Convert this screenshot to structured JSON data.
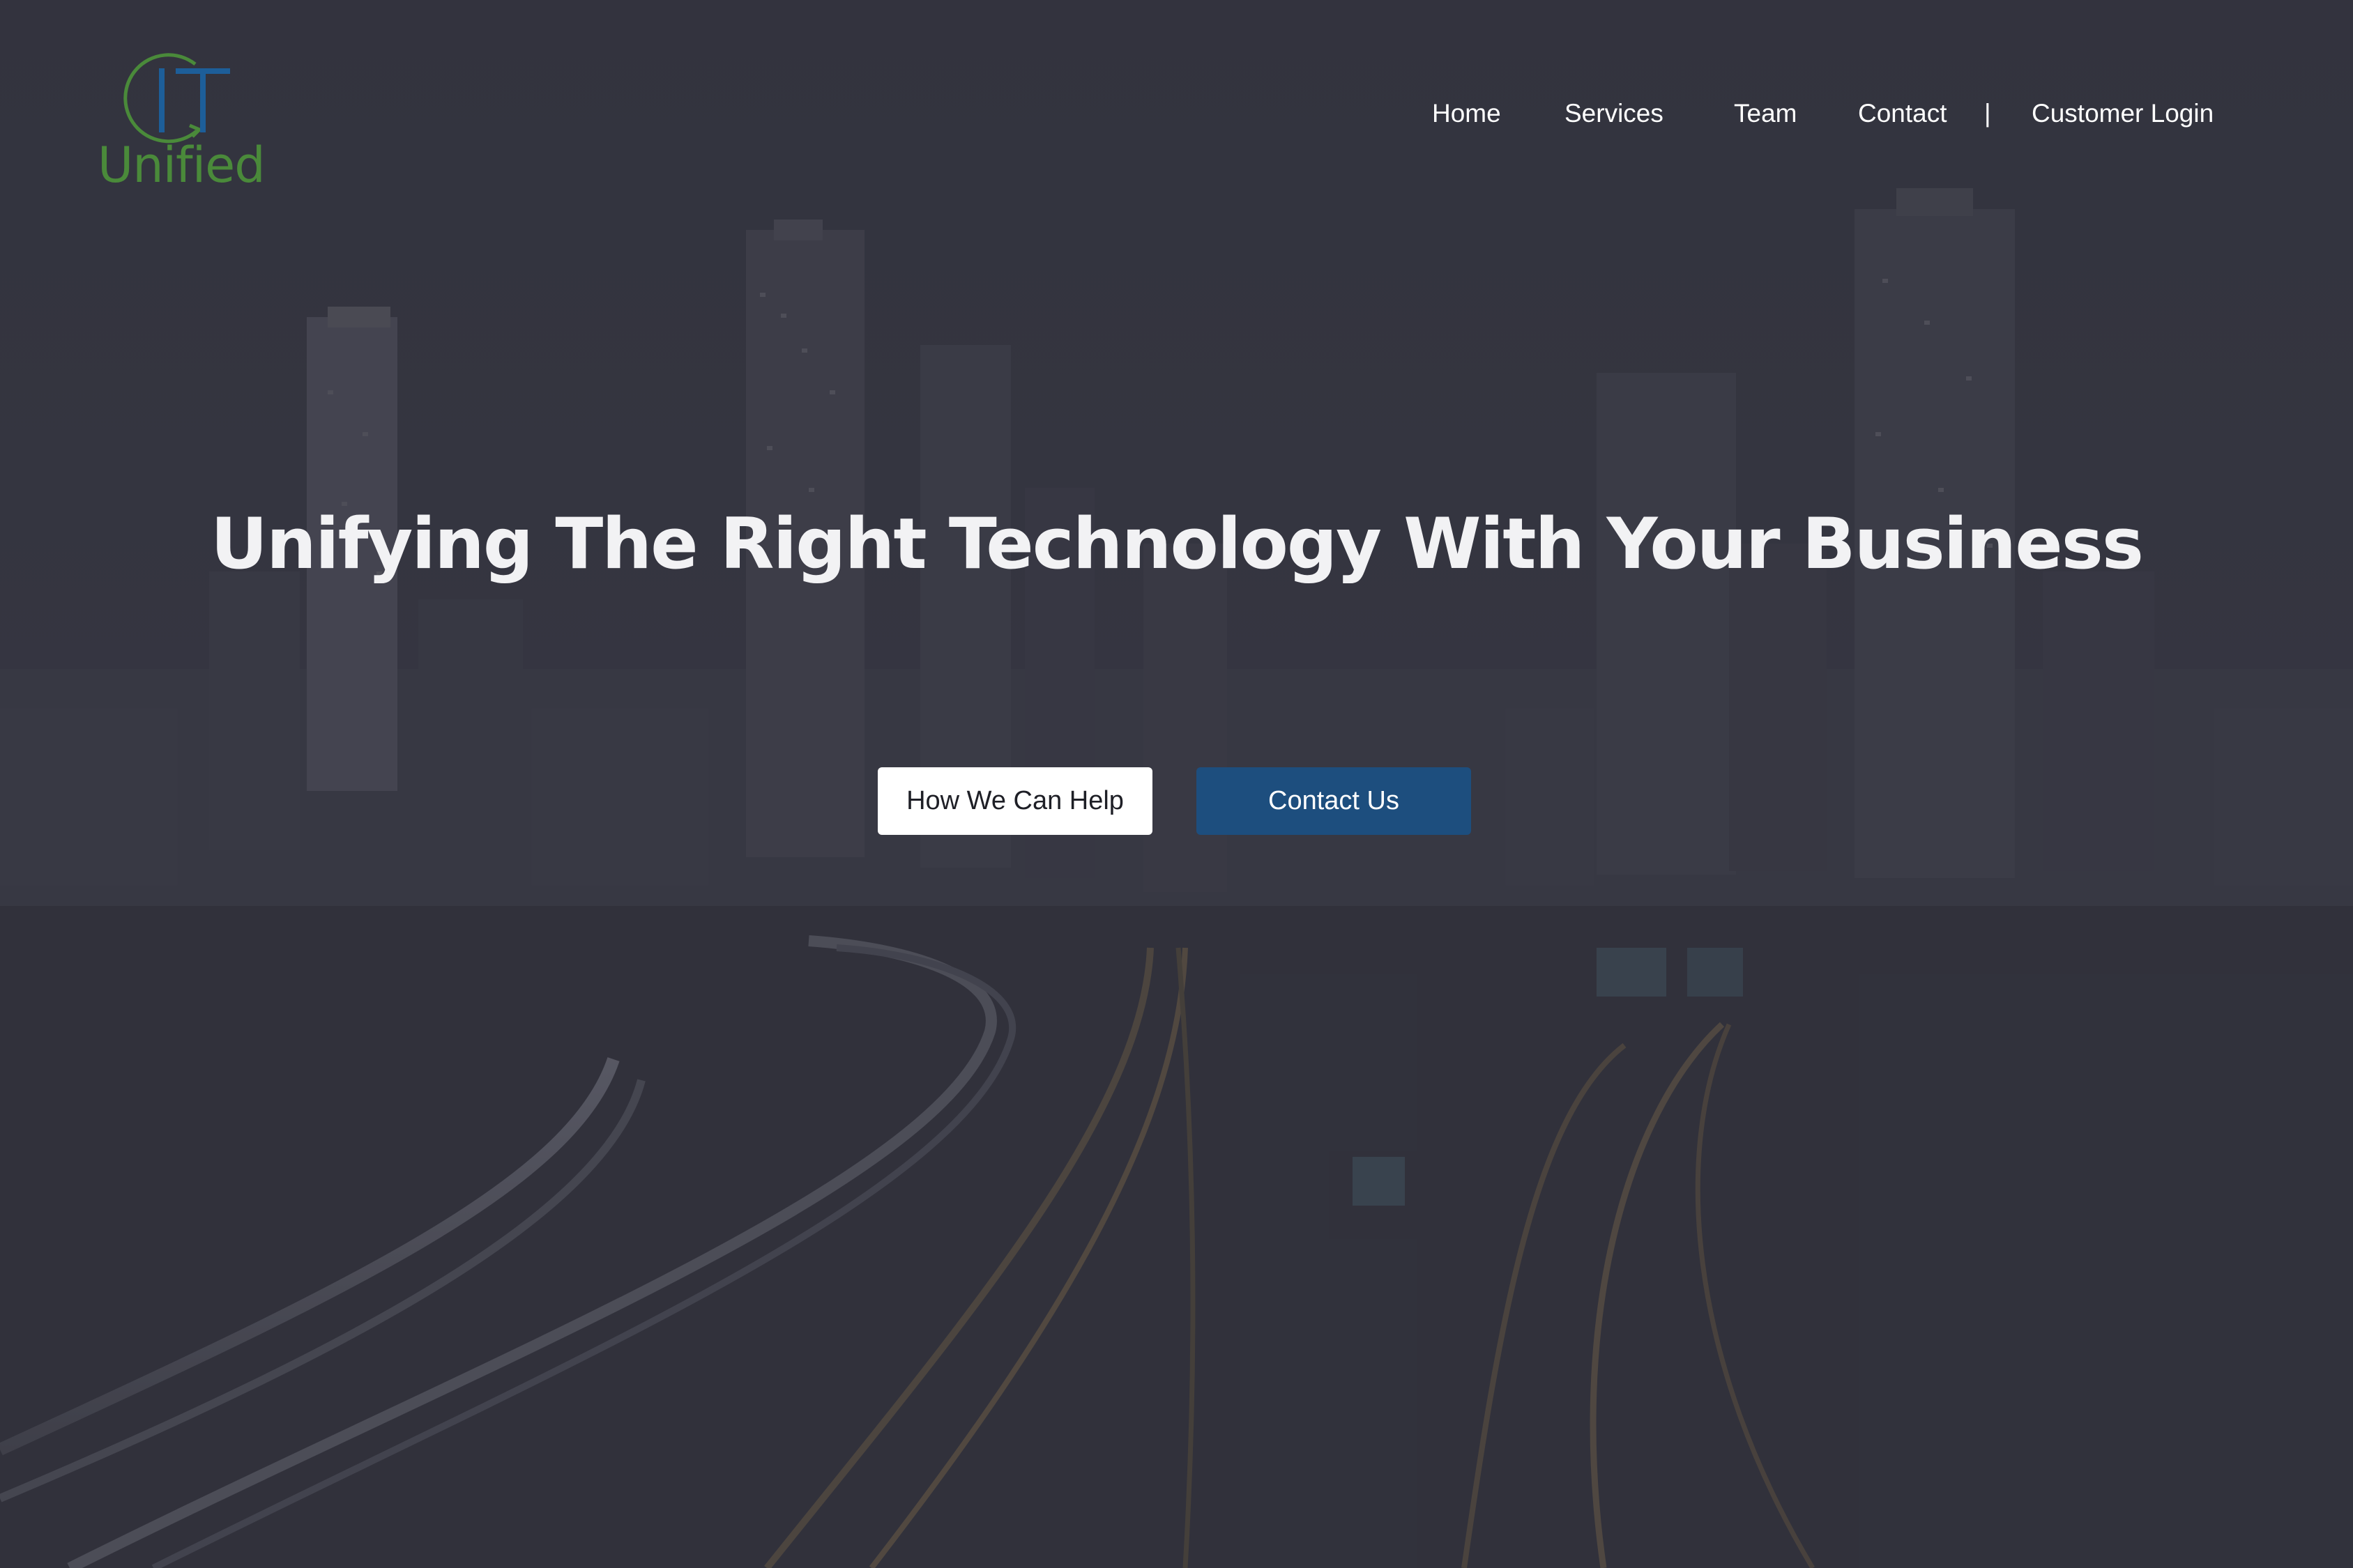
{
  "brand": {
    "logo_letters": "IT",
    "logo_word": "Unified",
    "color_green": "#4a8a3a",
    "color_blue": "#1d5e99"
  },
  "nav": {
    "items": [
      {
        "label": "Home"
      },
      {
        "label": "Services"
      },
      {
        "label": "Team"
      },
      {
        "label": "Contact"
      }
    ],
    "separator": "|",
    "login_label": "Customer Login"
  },
  "hero": {
    "headline": "Unifying The Right Technology With Your Business",
    "background": "city-skyline-night-highway-image",
    "primary_button": "How We Can Help",
    "secondary_button": "Contact Us",
    "accent_color": "#1d4e7e"
  }
}
